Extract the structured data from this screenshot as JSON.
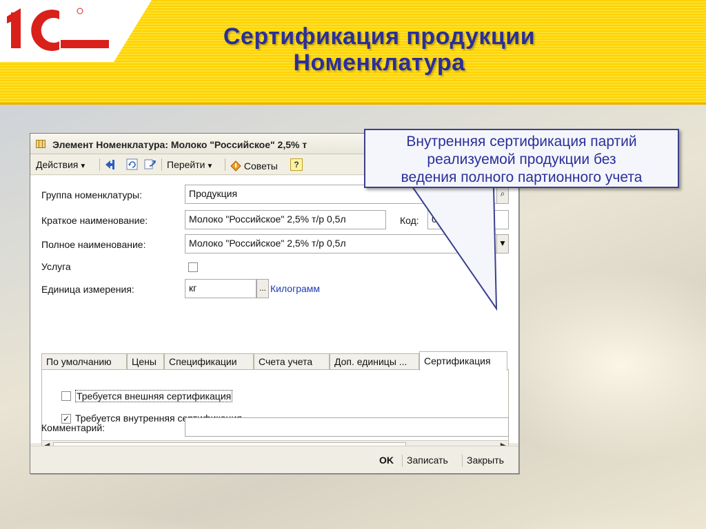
{
  "slide": {
    "title_line1": "Сертификация продукции",
    "title_line2": "Номенклатура",
    "logo_text": "1С",
    "brand_color": "#ffd200",
    "title_color": "#2a2f9a"
  },
  "window": {
    "title": "Элемент Номенклатура: Молоко \"Российское\" 2,5% т",
    "toolbar": {
      "actions": "Действия",
      "goto": "Перейти",
      "tips": "Советы",
      "help": "?"
    }
  },
  "form": {
    "group_label": "Группа номенклатуры:",
    "group_value": "Продукция",
    "short_name_label": "Краткое наименование:",
    "short_name_value": "Молоко \"Российское\" 2,5% т/р 0,5л",
    "code_label": "Код:",
    "code_value": "00",
    "full_name_label": "Полное наименование:",
    "full_name_value": "Молоко \"Российское\" 2,5% т/р 0,5л",
    "service_label": "Услуга",
    "service_checked": false,
    "unit_label": "Единица измерения:",
    "unit_value": "кг",
    "unit_button": "...",
    "unit_link": "Килограмм",
    "comment_label": "Комментарий:",
    "comment_value": ""
  },
  "tabs": [
    {
      "label": "По умолчанию",
      "active": false
    },
    {
      "label": "Цены",
      "active": false
    },
    {
      "label": "Спецификации",
      "active": false
    },
    {
      "label": "Счета учета",
      "active": false
    },
    {
      "label": "Доп. единицы ...",
      "active": false
    },
    {
      "label": "Сертификация",
      "active": true
    }
  ],
  "certification": {
    "external_label": "Требуется внешняя сертификация",
    "external_checked": false,
    "internal_label": "Требуется внутренняя сертификация",
    "internal_checked": true
  },
  "buttons": {
    "ok": "OK",
    "save": "Записать",
    "close": "Закрыть"
  },
  "callout": {
    "line1": "Внутренняя сертификация партий",
    "line2": "реализуемой продукции без",
    "line3": "ведения полного партионного учета"
  }
}
